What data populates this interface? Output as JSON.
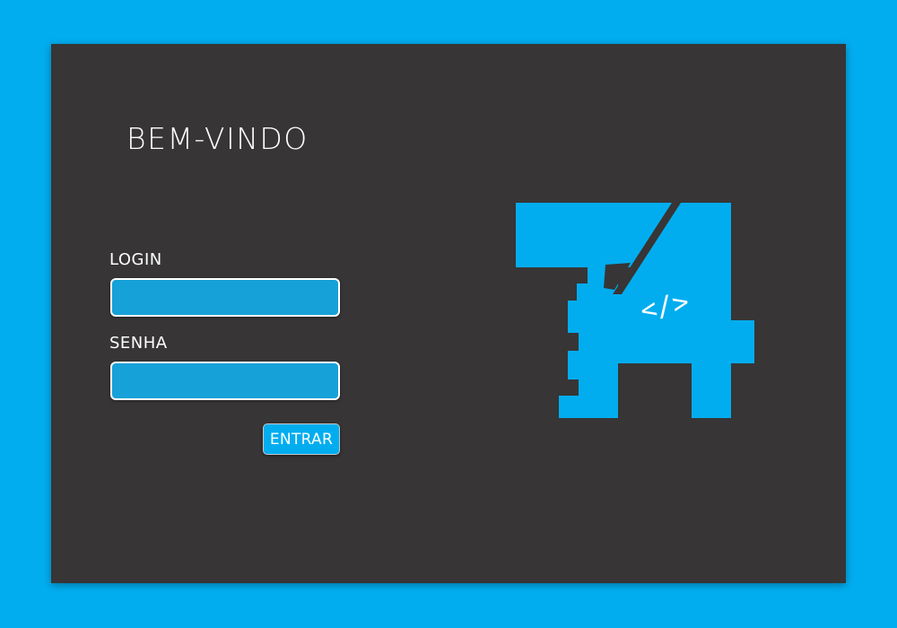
{
  "welcome": {
    "title": "BEM-VINDO"
  },
  "form": {
    "login_label": "LOGIN",
    "login_value": "",
    "senha_label": "SENHA",
    "senha_value": "",
    "submit_label": "ENTRAR"
  },
  "logo": {
    "icon": "t4-gear-logo-icon",
    "mark": "</>"
  },
  "colors": {
    "background": "#02adef",
    "panel": "#373536",
    "accent": "#02adef",
    "field": "#16a1d8",
    "text": "#ffffff"
  }
}
